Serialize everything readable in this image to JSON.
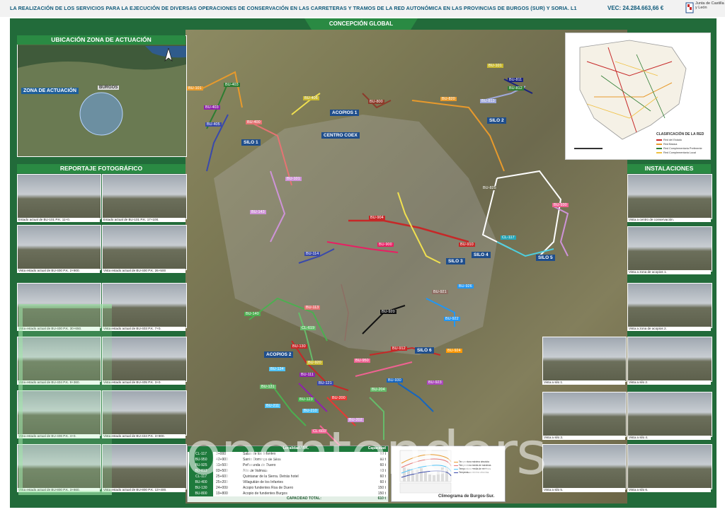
{
  "header": {
    "title": "LA REALIZACIÓN DE LOS SERVICIOS PARA LA EJECUCIÓN DE DIVERSAS OPERACIONES DE CONSERVACIÓN EN LAS CARRETERAS Y TRAMOS DE LA RED AUTONÓMICA EN LAS PROVINCIAS DE BURGOS (SUR) Y SORIA. L1",
    "pec": "VEC:  24.284.663,66 €",
    "logo_text": "Junta de Castilla y León"
  },
  "banner": "CONCEPCIÓN GLOBAL",
  "location": {
    "title": "UBICACIÓN ZONA DE ACTUACIÓN",
    "zone_label": "ZONA DE ACTUACIÓN",
    "city_label": "BURGOS"
  },
  "photos": {
    "title": "REPORTAJE FOTOGRÁFICO",
    "captions": [
      "Estado actual de BU-101 P.K. 11+0.",
      "Estado actual de BU-101 P.K. 17+100.",
      "Vista estado actual de BU-400 P.K. 2+900.",
      "Vista estado actual de BU-400 P.K. 26+500",
      "Vista estado actual de BU-400 P.K. 30+650.",
      "Vista estado actual de BU-403 P.K. 7+0.",
      "Vista estado actual de BU-404 P.K. 9+360.",
      "Vista estado actual de BU-405 P.K. 3+0.",
      "Vista estado actual de BU-406 P.K. 4+0.",
      "Vista estado actual de BU-434 P.K. 3+900.",
      "Vista estado actual de BU-800 P.K. 3+660.",
      "Vista estado actual de BU-800 P.K. 13+400."
    ]
  },
  "installations": {
    "title": "INSTALACIONES",
    "captions": [
      "Vista a centro de conservación.",
      "Vista a zona de acopios 1.",
      "Vista a zona de acopios 2.",
      "Vista a silo 1.",
      "Vista a silo 2.",
      "Vista a silo 3.",
      "Vista a silo 4.",
      "Vista a silo 5.",
      "Vista a silo 6."
    ]
  },
  "map_labels": {
    "facilities": [
      "ACOPIOS 1",
      "CENTRO COEX",
      "SILO 1",
      "SILO 2",
      "SILO 3",
      "SILO 4",
      "SILO 5",
      "ACOPIOS 2",
      "SILO 6"
    ],
    "roads": [
      {
        "label": "BU-403",
        "color": "#2e7d32"
      },
      {
        "label": "BU-101",
        "color": "#e89a2c"
      },
      {
        "label": "BU-403",
        "color": "#8e24aa"
      },
      {
        "label": "BU-405",
        "color": "#3949ab"
      },
      {
        "label": "BU-400",
        "color": "#e57373"
      },
      {
        "label": "BU-406",
        "color": "#f0e050"
      },
      {
        "label": "BU-800",
        "color": "#8d3b2b"
      },
      {
        "label": "BU-820",
        "color": "#e89a2c"
      },
      {
        "label": "BU-813",
        "color": "#9fa8da"
      },
      {
        "label": "BU-811",
        "color": "#1a237e"
      },
      {
        "label": "BU-812",
        "color": "#2e7d32"
      },
      {
        "label": "BU-101",
        "color": "#f0e050"
      },
      {
        "label": "BU-101",
        "color": "#ce93d8"
      },
      {
        "label": "BU-143",
        "color": "#ce93d8"
      },
      {
        "label": "BU-825",
        "color": "#ffffff"
      },
      {
        "label": "BU-904",
        "color": "#c62828"
      },
      {
        "label": "BU-910",
        "color": "#c62828"
      },
      {
        "label": "BU-900",
        "color": "#e91e63"
      },
      {
        "label": "BU-114",
        "color": "#3949ab"
      },
      {
        "label": "BU-930",
        "color": "#f06292"
      },
      {
        "label": "CL-117",
        "color": "#4dd0e1"
      },
      {
        "label": "BU-921",
        "color": "#8d6e63"
      },
      {
        "label": "BU-926",
        "color": "#2196f3"
      },
      {
        "label": "BU-920",
        "color": "#111111"
      },
      {
        "label": "BU-922",
        "color": "#2196f3"
      },
      {
        "label": "BU-140",
        "color": "#4caf50"
      },
      {
        "label": "BU-113",
        "color": "#e57373"
      },
      {
        "label": "CL-619",
        "color": "#66bb6a"
      },
      {
        "label": "BU-130",
        "color": "#c62828"
      },
      {
        "label": "BU-912",
        "color": "#c62828"
      },
      {
        "label": "BU-924",
        "color": "#ff9800"
      },
      {
        "label": "BU-134",
        "color": "#4fc3f7"
      },
      {
        "label": "BU-920",
        "color": "#f0e050"
      },
      {
        "label": "BU-950",
        "color": "#f06292"
      },
      {
        "label": "BU-111",
        "color": "#8e24aa"
      },
      {
        "label": "BU-121",
        "color": "#3949ab"
      },
      {
        "label": "BU-930",
        "color": "#1565c0"
      },
      {
        "label": "BU-923",
        "color": "#ab47bc"
      },
      {
        "label": "BU-131",
        "color": "#66bb6a"
      },
      {
        "label": "BU-123",
        "color": "#4caf50"
      },
      {
        "label": "BU-200",
        "color": "#e53935"
      },
      {
        "label": "BU-204",
        "color": "#66bb6a"
      },
      {
        "label": "BU-211",
        "color": "#4fc3f7"
      },
      {
        "label": "BU-210",
        "color": "#4fc3f7"
      },
      {
        "label": "BU-202",
        "color": "#ce93d8"
      },
      {
        "label": "CL-603",
        "color": "#f06292"
      }
    ]
  },
  "minimap": {
    "legend_title": "CLASIFICACIÓN DE LA RED",
    "legend_items": [
      {
        "label": "Red del Estado",
        "color": "#c62828"
      },
      {
        "label": "Red Básica",
        "color": "#e89a2c"
      },
      {
        "label": "Red Complementaria Preferente",
        "color": "#2e7d32"
      },
      {
        "label": "Red Complementaria Local",
        "color": "#f0c040"
      }
    ]
  },
  "table": {
    "headers": [
      "Localidad / P.K.",
      "Capacidad"
    ],
    "rows": [
      {
        "road": "CL-117",
        "pk": "3+000",
        "place": "Salas de los Infantes",
        "cap": "60 t"
      },
      {
        "road": "BU-950",
        "pk": "42+900",
        "place": "Santo Domingo de Silos",
        "cap": "60 t"
      },
      {
        "road": "BU-925",
        "pk": "31+500",
        "place": "Peñaranda de Duero",
        "cap": "60 t"
      },
      {
        "road": "BU-813",
        "pk": "03+500",
        "place": "Alto de Valmala",
        "cap": "60 t"
      },
      {
        "road": "CL-117",
        "pk": "25+600",
        "place": "Quintanar de la Sierra. Detrás hotel",
        "cap": "60 t"
      },
      {
        "road": "BU-400",
        "pk": "25+200",
        "place": "Villagutián de los Infantes",
        "cap": "60 t"
      },
      {
        "road": "BU-130",
        "pk": "24+000",
        "place": "Acopio fundentes Roa de Duero",
        "cap": "150 t"
      },
      {
        "road": "BU-800",
        "pk": "19+800",
        "place": "Acopio de fundentes Burgos",
        "cap": "150 t"
      }
    ],
    "total_label": "CAPACIDAD TOTAL:",
    "total_value": "610 t"
  },
  "climogram": {
    "title": "Climograma de Burgos-Sur.",
    "legend": [
      "Temperatura máxima absoluta",
      "Temperatura media de máximas",
      "Temperatura media de mínimas",
      "Temperatura mínima absoluta"
    ]
  },
  "watermark": "opentenders"
}
